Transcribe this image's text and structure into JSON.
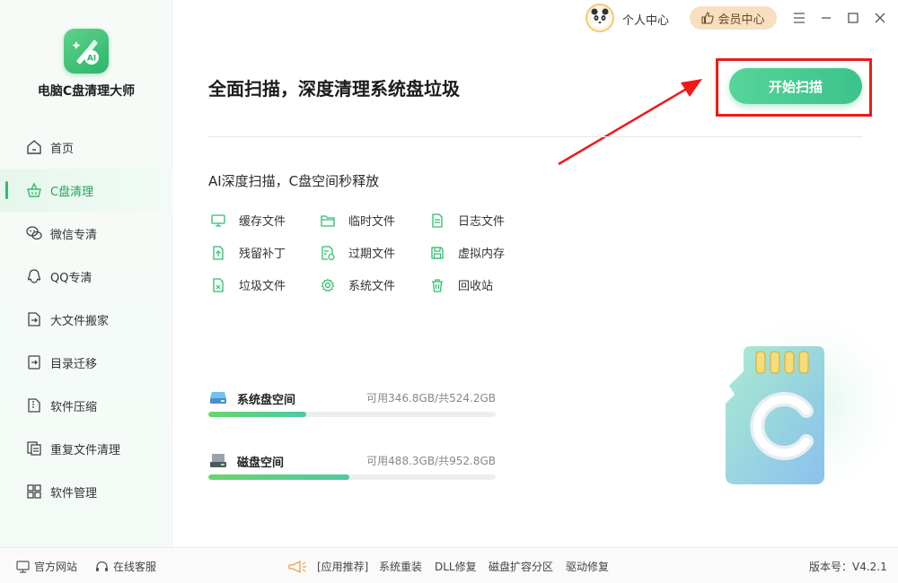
{
  "app": {
    "name": "电脑C盘清理大师",
    "version": "版本号：V4.2.1"
  },
  "sidebar": {
    "items": [
      {
        "label": "首页",
        "icon": "home-icon"
      },
      {
        "label": "C盘清理",
        "icon": "broom-basket-icon",
        "active": true
      },
      {
        "label": "微信专清",
        "icon": "wechat-icon"
      },
      {
        "label": "QQ专清",
        "icon": "qq-icon"
      },
      {
        "label": "大文件搬家",
        "icon": "file-move-icon"
      },
      {
        "label": "目录迁移",
        "icon": "folder-migrate-icon"
      },
      {
        "label": "软件压缩",
        "icon": "zip-icon"
      },
      {
        "label": "重复文件清理",
        "icon": "duplicate-file-icon"
      },
      {
        "label": "软件管理",
        "icon": "apps-grid-icon"
      }
    ]
  },
  "topbar": {
    "user_center": "个人中心",
    "vip": "会员中心"
  },
  "main": {
    "title": "全面扫描，深度清理系统盘垃圾",
    "scan_button": "开始扫描",
    "subtitle": "AI深度扫描，C盘空间秒释放",
    "features": [
      {
        "label": "缓存文件",
        "icon": "monitor-icon"
      },
      {
        "label": "临时文件",
        "icon": "folder-icon"
      },
      {
        "label": "日志文件",
        "icon": "log-file-icon"
      },
      {
        "label": "残留补丁",
        "icon": "patch-upload-icon"
      },
      {
        "label": "过期文件",
        "icon": "expired-file-icon"
      },
      {
        "label": "虚拟内存",
        "icon": "memory-save-icon"
      },
      {
        "label": "垃圾文件",
        "icon": "junk-file-icon"
      },
      {
        "label": "系统文件",
        "icon": "gear-icon"
      },
      {
        "label": "回收站",
        "icon": "trash-icon"
      }
    ],
    "disks": [
      {
        "name": "系统盘空间",
        "info": "可用346.8GB/共524.2GB",
        "used_fraction": 0.34
      },
      {
        "name": "磁盘空间",
        "info": "可用488.3GB/共952.8GB",
        "used_fraction": 0.49
      }
    ]
  },
  "footer": {
    "official_site": "官方网站",
    "online_service": "在线客服",
    "recommend": "[应用推荐]",
    "links": [
      "系统重装",
      "DLL修复",
      "磁盘扩容分区",
      "驱动修复"
    ]
  },
  "colors": {
    "accent": "#2fbd6d",
    "scan_button": "#4ccb92",
    "highlight_box": "#f01818",
    "vip_bg": "#f7dfc0"
  }
}
